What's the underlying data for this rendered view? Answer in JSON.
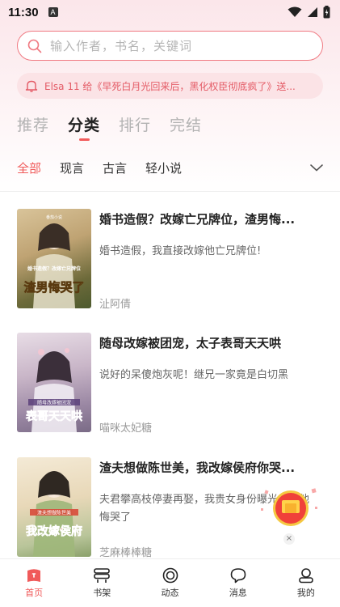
{
  "status_bar": {
    "time": "11:30",
    "notif_letter": "A"
  },
  "search": {
    "placeholder": "输入作者，书名，关键词"
  },
  "notice": {
    "text": "Elsa 11 给《早死白月光回来后，黑化权臣彻底疯了》送..."
  },
  "main_tabs": [
    {
      "label": "推荐",
      "active": false
    },
    {
      "label": "分类",
      "active": true
    },
    {
      "label": "排行",
      "active": false
    },
    {
      "label": "完结",
      "active": false
    }
  ],
  "sub_tabs": [
    {
      "label": "全部",
      "active": true
    },
    {
      "label": "现言",
      "active": false
    },
    {
      "label": "古言",
      "active": false
    },
    {
      "label": "轻小说",
      "active": false
    }
  ],
  "books": [
    {
      "title": "婚书造假？改嫁亡兄牌位，渣男悔...",
      "description": "婚书造假，我直接改嫁他亡兄牌位!",
      "author": "沚阿倩",
      "cover_text": "渣男悔哭了",
      "cover_subtext": "婚书造假？改嫁亡兄牌位",
      "cover_brand": "番茄小说",
      "cover_colors": [
        "#bfa373",
        "#4d5a2e"
      ]
    },
    {
      "title": "随母改嫁被团宠，太子表哥天天哄",
      "description": "说好的呆傻炮灰呢！继兄一家竟是白切黑",
      "author": "喵咪太妃糖",
      "cover_text": "表哥天天哄",
      "cover_subtext": "随母改嫁被团宠",
      "cover_brand": "",
      "cover_colors": [
        "#c9b6c8",
        "#7a6b86"
      ]
    },
    {
      "title": "渣夫想做陈世美，我改嫁侯府你哭...",
      "description": "夫君攀高枝停妻再娶，我贵女身份曝光后，他悔哭了",
      "author": "芝麻棒棒糖",
      "cover_text": "我改嫁侯府",
      "cover_subtext": "渣夫想做陈世美",
      "cover_brand": "",
      "cover_colors": [
        "#e8d8b8",
        "#8aa06a"
      ]
    }
  ],
  "float_close": "×",
  "bottom_nav": [
    {
      "label": "首页",
      "icon": "home-icon",
      "active": true
    },
    {
      "label": "书架",
      "icon": "bookshelf-icon",
      "active": false
    },
    {
      "label": "动态",
      "icon": "feed-icon",
      "active": false
    },
    {
      "label": "消息",
      "icon": "message-icon",
      "active": false
    },
    {
      "label": "我的",
      "icon": "profile-icon",
      "active": false
    }
  ],
  "colors": {
    "accent": "#f05a5a",
    "notice_bg": "#fbe3e6",
    "search_border": "#f07a82"
  }
}
